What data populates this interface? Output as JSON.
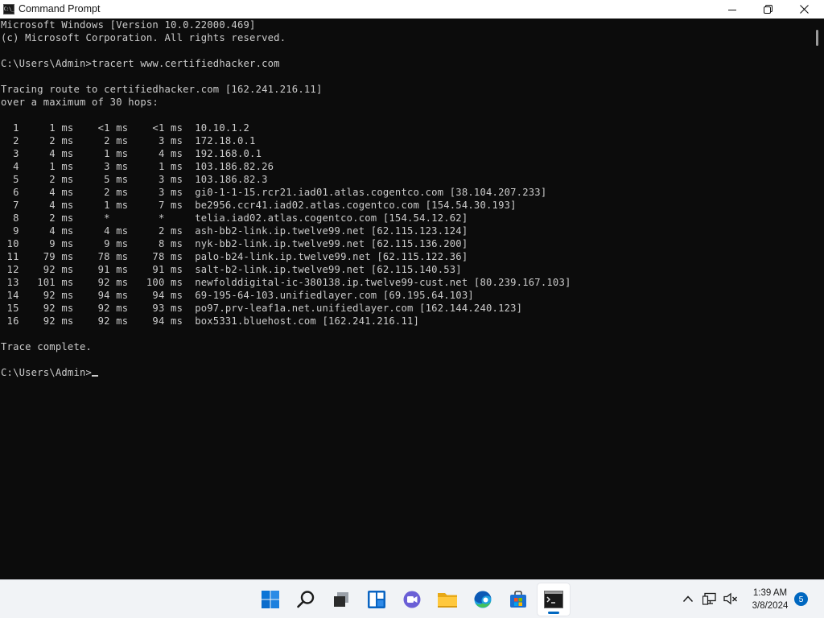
{
  "window": {
    "title": "Command Prompt",
    "app_icon_text": "C:\\_"
  },
  "console": {
    "lines": [
      "Microsoft Windows [Version 10.0.22000.469]",
      "(c) Microsoft Corporation. All rights reserved.",
      "",
      "C:\\Users\\Admin>tracert www.certifiedhacker.com",
      "",
      "Tracing route to certifiedhacker.com [162.241.216.11]",
      "over a maximum of 30 hops:",
      "",
      "  1     1 ms    <1 ms    <1 ms  10.10.1.2",
      "  2     2 ms     2 ms     3 ms  172.18.0.1",
      "  3     4 ms     1 ms     4 ms  192.168.0.1",
      "  4     1 ms     3 ms     1 ms  103.186.82.26",
      "  5     2 ms     5 ms     3 ms  103.186.82.3",
      "  6     4 ms     2 ms     3 ms  gi0-1-1-15.rcr21.iad01.atlas.cogentco.com [38.104.207.233]",
      "  7     4 ms     1 ms     7 ms  be2956.ccr41.iad02.atlas.cogentco.com [154.54.30.193]",
      "  8     2 ms     *        *     telia.iad02.atlas.cogentco.com [154.54.12.62]",
      "  9     4 ms     4 ms     2 ms  ash-bb2-link.ip.twelve99.net [62.115.123.124]",
      " 10     9 ms     9 ms     8 ms  nyk-bb2-link.ip.twelve99.net [62.115.136.200]",
      " 11    79 ms    78 ms    78 ms  palo-b24-link.ip.twelve99.net [62.115.122.36]",
      " 12    92 ms    91 ms    91 ms  salt-b2-link.ip.twelve99.net [62.115.140.53]",
      " 13   101 ms    92 ms   100 ms  newfolddigital-ic-380138.ip.twelve99-cust.net [80.239.167.103]",
      " 14    92 ms    94 ms    94 ms  69-195-64-103.unifiedlayer.com [69.195.64.103]",
      " 15    92 ms    92 ms    93 ms  po97.prv-leaf1a.net.unifiedlayer.com [162.144.240.123]",
      " 16    92 ms    92 ms    94 ms  box5331.bluehost.com [162.241.216.11]",
      "",
      "Trace complete.",
      ""
    ],
    "prompt": "C:\\Users\\Admin>"
  },
  "taskbar": {
    "items": [
      {
        "name": "start-button",
        "icon": "windows-logo-icon"
      },
      {
        "name": "search-button",
        "icon": "search-icon"
      },
      {
        "name": "task-view-button",
        "icon": "task-view-icon"
      },
      {
        "name": "widgets-button",
        "icon": "widgets-icon"
      },
      {
        "name": "chat-button",
        "icon": "teams-chat-icon"
      },
      {
        "name": "file-explorer-button",
        "icon": "folder-icon"
      },
      {
        "name": "edge-button",
        "icon": "edge-icon"
      },
      {
        "name": "store-button",
        "icon": "store-icon"
      },
      {
        "name": "command-prompt-button",
        "icon": "terminal-icon",
        "active": true
      }
    ],
    "tray": {
      "time": "1:39 AM",
      "date": "3/8/2024",
      "notification_count": "5"
    }
  },
  "colors": {
    "console_bg": "#0c0c0c",
    "console_fg": "#cccccc",
    "accent": "#0067c0"
  }
}
